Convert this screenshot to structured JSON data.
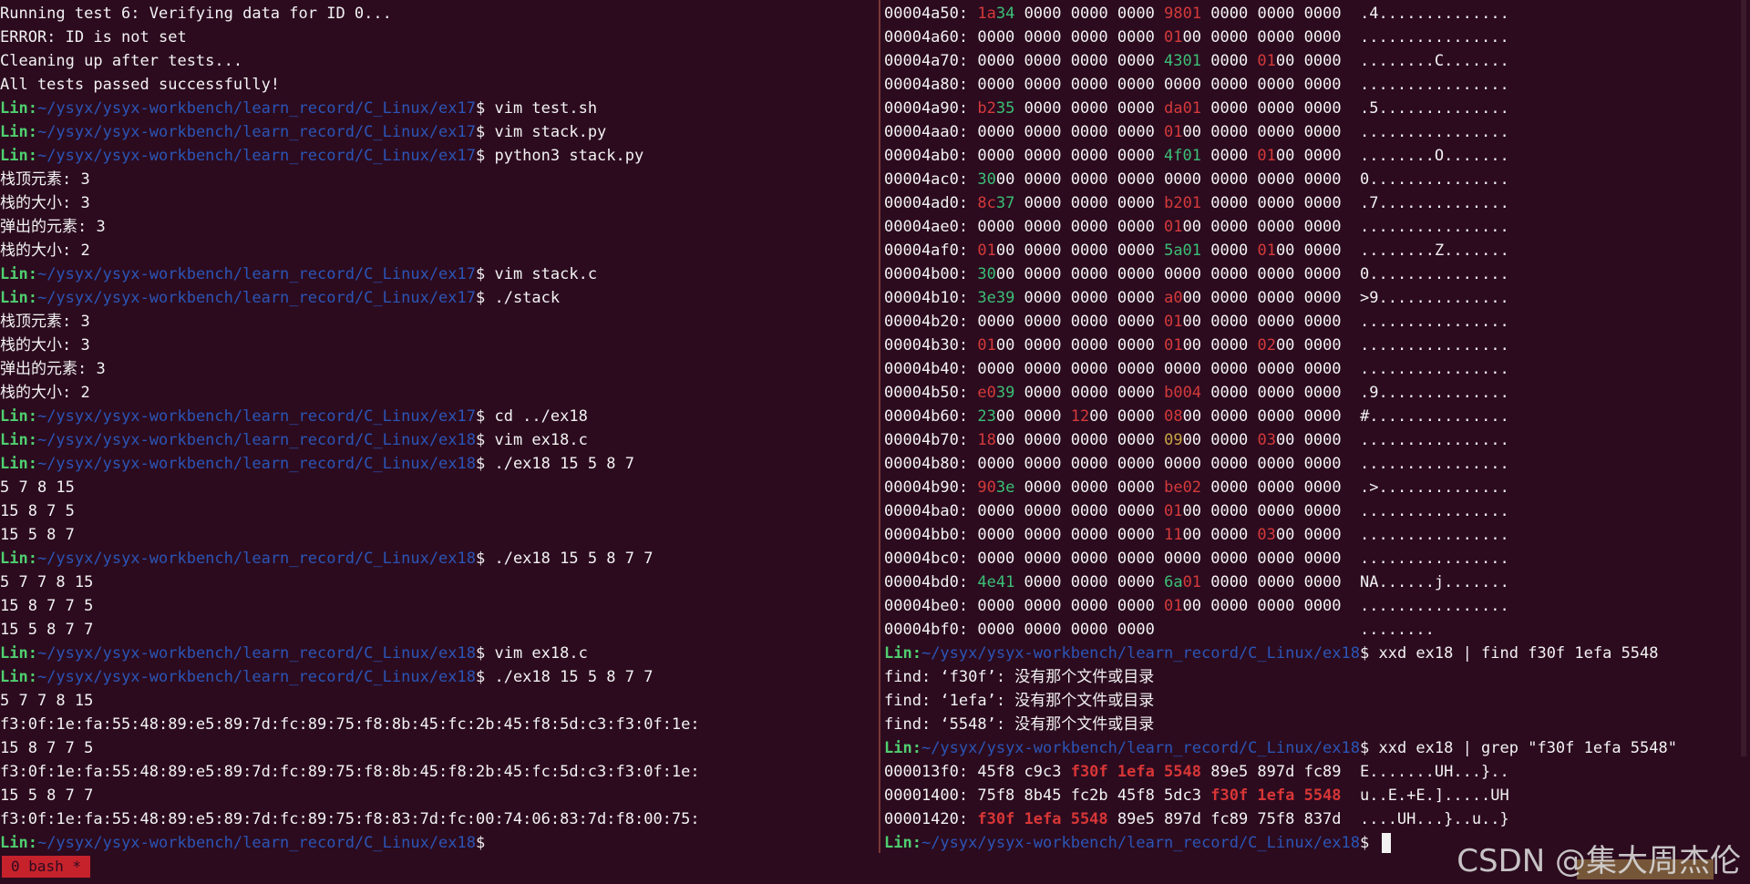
{
  "left_lines": [
    [
      {
        "t": "Running test 6: Verifying data for ID 0...",
        "c": "n"
      }
    ],
    [
      {
        "t": "ERROR: ID is not set",
        "c": "n"
      }
    ],
    [
      {
        "t": "Cleaning up after tests...",
        "c": "n"
      }
    ],
    [
      {
        "t": "All tests passed successfully!",
        "c": "n"
      }
    ],
    [
      {
        "t": "Lin:",
        "c": "g"
      },
      {
        "t": "~/ysyx/ysyx-workbench/learn_record/C_Linux/ex17",
        "c": "b"
      },
      {
        "t": "$ vim test.sh",
        "c": "n"
      }
    ],
    [
      {
        "t": "Lin:",
        "c": "g"
      },
      {
        "t": "~/ysyx/ysyx-workbench/learn_record/C_Linux/ex17",
        "c": "b"
      },
      {
        "t": "$ vim stack.py",
        "c": "n"
      }
    ],
    [
      {
        "t": "Lin:",
        "c": "g"
      },
      {
        "t": "~/ysyx/ysyx-workbench/learn_record/C_Linux/ex17",
        "c": "b"
      },
      {
        "t": "$ python3 stack.py",
        "c": "n"
      }
    ],
    [
      {
        "t": "栈顶元素: 3",
        "c": "n"
      }
    ],
    [
      {
        "t": "栈的大小: 3",
        "c": "n"
      }
    ],
    [
      {
        "t": "弹出的元素: 3",
        "c": "n"
      }
    ],
    [
      {
        "t": "栈的大小: 2",
        "c": "n"
      }
    ],
    [
      {
        "t": "Lin:",
        "c": "g"
      },
      {
        "t": "~/ysyx/ysyx-workbench/learn_record/C_Linux/ex17",
        "c": "b"
      },
      {
        "t": "$ vim stack.c",
        "c": "n"
      }
    ],
    [
      {
        "t": "Lin:",
        "c": "g"
      },
      {
        "t": "~/ysyx/ysyx-workbench/learn_record/C_Linux/ex17",
        "c": "b"
      },
      {
        "t": "$ ./stack",
        "c": "n"
      }
    ],
    [
      {
        "t": "栈顶元素: 3",
        "c": "n"
      }
    ],
    [
      {
        "t": "栈的大小: 3",
        "c": "n"
      }
    ],
    [
      {
        "t": "弹出的元素: 3",
        "c": "n"
      }
    ],
    [
      {
        "t": "栈的大小: 2",
        "c": "n"
      }
    ],
    [
      {
        "t": "Lin:",
        "c": "g"
      },
      {
        "t": "~/ysyx/ysyx-workbench/learn_record/C_Linux/ex17",
        "c": "b"
      },
      {
        "t": "$ cd ../ex18",
        "c": "n"
      }
    ],
    [
      {
        "t": "Lin:",
        "c": "g"
      },
      {
        "t": "~/ysyx/ysyx-workbench/learn_record/C_Linux/ex18",
        "c": "b"
      },
      {
        "t": "$ vim ex18.c",
        "c": "n"
      }
    ],
    [
      {
        "t": "Lin:",
        "c": "g"
      },
      {
        "t": "~/ysyx/ysyx-workbench/learn_record/C_Linux/ex18",
        "c": "b"
      },
      {
        "t": "$ ./ex18 15 5 8 7",
        "c": "n"
      }
    ],
    [
      {
        "t": "5 7 8 15",
        "c": "n"
      }
    ],
    [
      {
        "t": "15 8 7 5",
        "c": "n"
      }
    ],
    [
      {
        "t": "15 5 8 7",
        "c": "n"
      }
    ],
    [
      {
        "t": "Lin:",
        "c": "g"
      },
      {
        "t": "~/ysyx/ysyx-workbench/learn_record/C_Linux/ex18",
        "c": "b"
      },
      {
        "t": "$ ./ex18 15 5 8 7 7",
        "c": "n"
      }
    ],
    [
      {
        "t": "5 7 7 8 15",
        "c": "n"
      }
    ],
    [
      {
        "t": "15 8 7 7 5",
        "c": "n"
      }
    ],
    [
      {
        "t": "15 5 8 7 7",
        "c": "n"
      }
    ],
    [
      {
        "t": "Lin:",
        "c": "g"
      },
      {
        "t": "~/ysyx/ysyx-workbench/learn_record/C_Linux/ex18",
        "c": "b"
      },
      {
        "t": "$ vim ex18.c",
        "c": "n"
      }
    ],
    [
      {
        "t": "Lin:",
        "c": "g"
      },
      {
        "t": "~/ysyx/ysyx-workbench/learn_record/C_Linux/ex18",
        "c": "b"
      },
      {
        "t": "$ ./ex18 15 5 8 7 7",
        "c": "n"
      }
    ],
    [
      {
        "t": "5 7 7 8 15",
        "c": "n"
      }
    ],
    [
      {
        "t": "f3:0f:1e:fa:55:48:89:e5:89:7d:fc:89:75:f8:8b:45:fc:2b:45:f8:5d:c3:f3:0f:1e:",
        "c": "n"
      }
    ],
    [
      {
        "t": "15 8 7 7 5",
        "c": "n"
      }
    ],
    [
      {
        "t": "f3:0f:1e:fa:55:48:89:e5:89:7d:fc:89:75:f8:8b:45:f8:2b:45:fc:5d:c3:f3:0f:1e:",
        "c": "n"
      }
    ],
    [
      {
        "t": "15 5 8 7 7",
        "c": "n"
      }
    ],
    [
      {
        "t": "f3:0f:1e:fa:55:48:89:e5:89:7d:fc:89:75:f8:83:7d:fc:00:74:06:83:7d:f8:00:75:",
        "c": "n"
      }
    ],
    [
      {
        "t": "Lin:",
        "c": "g"
      },
      {
        "t": "~/ysyx/ysyx-workbench/learn_record/C_Linux/ex18",
        "c": "b"
      },
      {
        "t": "$",
        "c": "n"
      }
    ]
  ],
  "right_lines": [
    [
      {
        "t": "00004a50: ",
        "c": "n"
      },
      {
        "t": "1a",
        "c": "red"
      },
      {
        "t": "34",
        "c": "grn"
      },
      {
        "t": " 0000 0000 0000 ",
        "c": "n"
      },
      {
        "t": "98",
        "c": "red"
      },
      {
        "t": "01",
        "c": "red"
      },
      {
        "t": " 0000 0000 0000  ",
        "c": "n"
      },
      {
        "t": ".4..............",
        "c": "n"
      }
    ],
    [
      {
        "t": "00004a60: 0000 0000 0000 0000 ",
        "c": "n"
      },
      {
        "t": "01",
        "c": "red"
      },
      {
        "t": "00 0000 0000 0000  ",
        "c": "n"
      },
      {
        "t": "................",
        "c": "n"
      }
    ],
    [
      {
        "t": "00004a70: 0000 0000 0000 0000 ",
        "c": "n"
      },
      {
        "t": "4301",
        "c": "grn"
      },
      {
        "t": " 0000 ",
        "c": "n"
      },
      {
        "t": "01",
        "c": "red"
      },
      {
        "t": "00 0000  ",
        "c": "n"
      },
      {
        "t": "........C.......",
        "c": "n"
      }
    ],
    [
      {
        "t": "00004a80: 0000 0000 0000 0000 0000 0000 0000 0000  ................",
        "c": "n"
      }
    ],
    [
      {
        "t": "00004a90: ",
        "c": "n"
      },
      {
        "t": "b2",
        "c": "red"
      },
      {
        "t": "35",
        "c": "grn"
      },
      {
        "t": " 0000 0000 0000 ",
        "c": "n"
      },
      {
        "t": "da01",
        "c": "red"
      },
      {
        "t": " 0000 0000 0000  ",
        "c": "n"
      },
      {
        "t": ".5..............",
        "c": "n"
      }
    ],
    [
      {
        "t": "00004aa0: 0000 0000 0000 0000 ",
        "c": "n"
      },
      {
        "t": "01",
        "c": "red"
      },
      {
        "t": "00 0000 0000 0000  ",
        "c": "n"
      },
      {
        "t": "................",
        "c": "n"
      }
    ],
    [
      {
        "t": "00004ab0: 0000 0000 0000 0000 ",
        "c": "n"
      },
      {
        "t": "4f01",
        "c": "grn"
      },
      {
        "t": " 0000 ",
        "c": "n"
      },
      {
        "t": "01",
        "c": "red"
      },
      {
        "t": "00 0000  ",
        "c": "n"
      },
      {
        "t": "........O.......",
        "c": "n"
      }
    ],
    [
      {
        "t": "00004ac0: ",
        "c": "n"
      },
      {
        "t": "30",
        "c": "grn"
      },
      {
        "t": "00 0000 0000 0000 0000 0000 0000 0000  ",
        "c": "n"
      },
      {
        "t": "0...............",
        "c": "n"
      }
    ],
    [
      {
        "t": "00004ad0: ",
        "c": "n"
      },
      {
        "t": "8c",
        "c": "red"
      },
      {
        "t": "37",
        "c": "grn"
      },
      {
        "t": " 0000 0000 0000 ",
        "c": "n"
      },
      {
        "t": "b201",
        "c": "red"
      },
      {
        "t": " 0000 0000 0000  ",
        "c": "n"
      },
      {
        "t": ".7..............",
        "c": "n"
      }
    ],
    [
      {
        "t": "00004ae0: 0000 0000 0000 0000 ",
        "c": "n"
      },
      {
        "t": "01",
        "c": "red"
      },
      {
        "t": "00 0000 0000 0000  ",
        "c": "n"
      },
      {
        "t": "................",
        "c": "n"
      }
    ],
    [
      {
        "t": "00004af0: ",
        "c": "n"
      },
      {
        "t": "01",
        "c": "red"
      },
      {
        "t": "00 0000 0000 0000 ",
        "c": "n"
      },
      {
        "t": "5a01",
        "c": "grn"
      },
      {
        "t": " 0000 ",
        "c": "n"
      },
      {
        "t": "01",
        "c": "red"
      },
      {
        "t": "00 0000  ",
        "c": "n"
      },
      {
        "t": "........Z.......",
        "c": "n"
      }
    ],
    [
      {
        "t": "00004b00: ",
        "c": "n"
      },
      {
        "t": "30",
        "c": "grn"
      },
      {
        "t": "00 0000 0000 0000 0000 0000 0000 0000  ",
        "c": "n"
      },
      {
        "t": "0...............",
        "c": "n"
      }
    ],
    [
      {
        "t": "00004b10: ",
        "c": "n"
      },
      {
        "t": "3e39",
        "c": "grn"
      },
      {
        "t": " 0000 0000 0000 ",
        "c": "n"
      },
      {
        "t": "a0",
        "c": "red"
      },
      {
        "t": "00 0000 0000 0000  ",
        "c": "n"
      },
      {
        "t": ">9..............",
        "c": "n"
      }
    ],
    [
      {
        "t": "00004b20: 0000 0000 0000 0000 ",
        "c": "n"
      },
      {
        "t": "01",
        "c": "red"
      },
      {
        "t": "00 0000 0000 0000  ",
        "c": "n"
      },
      {
        "t": "................",
        "c": "n"
      }
    ],
    [
      {
        "t": "00004b30: ",
        "c": "n"
      },
      {
        "t": "01",
        "c": "red"
      },
      {
        "t": "00 0000 0000 0000 ",
        "c": "n"
      },
      {
        "t": "01",
        "c": "red"
      },
      {
        "t": "00 0000 ",
        "c": "n"
      },
      {
        "t": "02",
        "c": "red"
      },
      {
        "t": "00 0000  ",
        "c": "n"
      },
      {
        "t": "................",
        "c": "n"
      }
    ],
    [
      {
        "t": "00004b40: 0000 0000 0000 0000 0000 0000 0000 0000  ................",
        "c": "n"
      }
    ],
    [
      {
        "t": "00004b50: ",
        "c": "n"
      },
      {
        "t": "e0",
        "c": "red"
      },
      {
        "t": "39",
        "c": "grn"
      },
      {
        "t": " 0000 0000 0000 ",
        "c": "n"
      },
      {
        "t": "b004",
        "c": "red"
      },
      {
        "t": " 0000 0000 0000  ",
        "c": "n"
      },
      {
        "t": ".9..............",
        "c": "n"
      }
    ],
    [
      {
        "t": "00004b60: ",
        "c": "n"
      },
      {
        "t": "23",
        "c": "grn"
      },
      {
        "t": "00 0000 ",
        "c": "n"
      },
      {
        "t": "12",
        "c": "red"
      },
      {
        "t": "00 0000 ",
        "c": "n"
      },
      {
        "t": "08",
        "c": "red"
      },
      {
        "t": "00 0000 0000 0000  ",
        "c": "n"
      },
      {
        "t": "#...............",
        "c": "n"
      }
    ],
    [
      {
        "t": "00004b70: ",
        "c": "n"
      },
      {
        "t": "18",
        "c": "red"
      },
      {
        "t": "00 0000 0000 0000 ",
        "c": "n"
      },
      {
        "t": "09",
        "c": "ylw"
      },
      {
        "t": "00 0000 ",
        "c": "n"
      },
      {
        "t": "03",
        "c": "red"
      },
      {
        "t": "00 0000  ",
        "c": "n"
      },
      {
        "t": "................",
        "c": "n"
      }
    ],
    [
      {
        "t": "00004b80: 0000 0000 0000 0000 0000 0000 0000 0000  ................",
        "c": "n"
      }
    ],
    [
      {
        "t": "00004b90: ",
        "c": "n"
      },
      {
        "t": "90",
        "c": "red"
      },
      {
        "t": "3e",
        "c": "grn"
      },
      {
        "t": " 0000 0000 0000 ",
        "c": "n"
      },
      {
        "t": "be02",
        "c": "red"
      },
      {
        "t": " 0000 0000 0000  ",
        "c": "n"
      },
      {
        "t": ".>..............",
        "c": "n"
      }
    ],
    [
      {
        "t": "00004ba0: 0000 0000 0000 0000 ",
        "c": "n"
      },
      {
        "t": "01",
        "c": "red"
      },
      {
        "t": "00 0000 0000 0000  ",
        "c": "n"
      },
      {
        "t": "................",
        "c": "n"
      }
    ],
    [
      {
        "t": "00004bb0: 0000 0000 0000 0000 ",
        "c": "n"
      },
      {
        "t": "11",
        "c": "red"
      },
      {
        "t": "00 0000 ",
        "c": "n"
      },
      {
        "t": "03",
        "c": "red"
      },
      {
        "t": "00 0000  ",
        "c": "n"
      },
      {
        "t": "................",
        "c": "n"
      }
    ],
    [
      {
        "t": "00004bc0: 0000 0000 0000 0000 0000 0000 0000 0000  ................",
        "c": "n"
      }
    ],
    [
      {
        "t": "00004bd0: ",
        "c": "n"
      },
      {
        "t": "4e41",
        "c": "grn"
      },
      {
        "t": " 0000 0000 0000 ",
        "c": "n"
      },
      {
        "t": "6a",
        "c": "grn"
      },
      {
        "t": "01",
        "c": "red"
      },
      {
        "t": " 0000 0000 0000  ",
        "c": "n"
      },
      {
        "t": "NA......j.......",
        "c": "n"
      }
    ],
    [
      {
        "t": "00004be0: 0000 0000 0000 0000 ",
        "c": "n"
      },
      {
        "t": "01",
        "c": "red"
      },
      {
        "t": "00 0000 0000 0000  ",
        "c": "n"
      },
      {
        "t": "................",
        "c": "n"
      }
    ],
    [
      {
        "t": "00004bf0: 0000 0000 0000 0000                      ........",
        "c": "n"
      }
    ],
    [
      {
        "t": "Lin:",
        "c": "g"
      },
      {
        "t": "~/ysyx/ysyx-workbench/learn_record/C_Linux/ex18",
        "c": "b"
      },
      {
        "t": "$ xxd ex18 | find f30f 1efa 5548",
        "c": "n"
      }
    ],
    [
      {
        "t": "find: ‘f30f’: 没有那个文件或目录",
        "c": "n"
      }
    ],
    [
      {
        "t": "find: ‘1efa’: 没有那个文件或目录",
        "c": "n"
      }
    ],
    [
      {
        "t": "find: ‘5548’: 没有那个文件或目录",
        "c": "n"
      }
    ],
    [
      {
        "t": "Lin:",
        "c": "g"
      },
      {
        "t": "~/ysyx/ysyx-workbench/learn_record/C_Linux/ex18",
        "c": "b"
      },
      {
        "t": "$ xxd ex18 | grep \"f30f 1efa 5548\"",
        "c": "n"
      }
    ],
    [
      {
        "t": "000013f0: 45f8 c9c3 ",
        "c": "n"
      },
      {
        "t": "f30f 1efa 5548",
        "c": "match"
      },
      {
        "t": " 89e5 897d fc89  E.......UH...}..",
        "c": "n"
      }
    ],
    [
      {
        "t": "00001400: 75f8 8b45 fc2b 45f8 5dc3 ",
        "c": "n"
      },
      {
        "t": "f30f 1efa 5548",
        "c": "match"
      },
      {
        "t": "  u..E.+E.].....UH",
        "c": "n"
      }
    ],
    [
      {
        "t": "00001420: ",
        "c": "n"
      },
      {
        "t": "f30f 1efa 5548",
        "c": "match"
      },
      {
        "t": " 89e5 897d fc89 75f8 837d  ....UH...}..u..}",
        "c": "n"
      }
    ],
    [
      {
        "t": "Lin:",
        "c": "g"
      },
      {
        "t": "~/ysyx/ysyx-workbench/learn_record/C_Linux/ex18",
        "c": "b"
      },
      {
        "t": "$ ",
        "c": "n"
      }
    ]
  ],
  "status": {
    "tab_label": "0 bash *",
    "watermark": "CSDN @集大周杰伦"
  },
  "colors": {
    "background": "#2c0b1f",
    "prompt_user": "#4fcf6f",
    "prompt_path": "#2b55b6",
    "match_red": "#d73636",
    "status_tab": "#c5222c"
  }
}
